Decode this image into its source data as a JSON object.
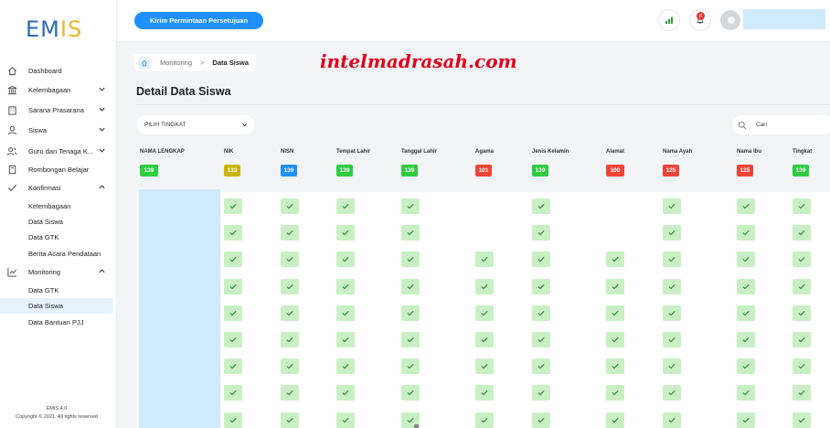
{
  "app": {
    "logo_main": "EM",
    "logo_accent": "IS"
  },
  "sidebar": {
    "items": [
      {
        "label": "Dashboard",
        "icon": "home-icon",
        "chevron": ""
      },
      {
        "label": "Kelembagaan",
        "icon": "institution-icon",
        "chevron": "down"
      },
      {
        "label": "Sarana Prasarana",
        "icon": "building-icon",
        "chevron": "down"
      },
      {
        "label": "Siswa",
        "icon": "user-icon",
        "chevron": "down"
      },
      {
        "label": "Guru dan Tenaga K...",
        "icon": "users-icon",
        "chevron": "down"
      },
      {
        "label": "Rombongan Belajar",
        "icon": "book-icon",
        "chevron": ""
      },
      {
        "label": "Konfirmasi",
        "icon": "check-icon",
        "chevron": "up"
      }
    ],
    "konfirmasi_sub": [
      "Kelembagaan",
      "Data Siswa",
      "Data GTK",
      "Berita Acara Pendataan"
    ],
    "monitoring": {
      "label": "Monitoring",
      "icon": "chart-line-icon",
      "chevron": "up"
    },
    "monitoring_sub": [
      "Data GTK",
      "Data Siswa",
      "Data Bantuan PJJ"
    ],
    "active_sub": "Data Siswa",
    "footer_version": "EMIS 4.0",
    "footer_copyright": "Copyright © 2021. All rights reserved"
  },
  "topbar": {
    "request_button": "Kirim Permintaan Persetujuan",
    "notification_count": "8",
    "icons": [
      "signal-bars-icon",
      "bell-icon",
      "avatar-icon"
    ]
  },
  "breadcrumb": {
    "parent": "Monitoring",
    "separator": ">",
    "current": "Data Siswa"
  },
  "watermark": "intelmadrasah.com",
  "page_title": "Detail Data Siswa",
  "filter": {
    "select_value": "PILIH TINGKAT",
    "search_placeholder": "Cari"
  },
  "colors": {
    "green": "#2ecc40",
    "yellow": "#c8b400",
    "blue": "#1e90ff",
    "red": "#f0443a",
    "check_bg": "#c9f0c4",
    "accent": "#1e90ff"
  },
  "table": {
    "columns": [
      {
        "label": "NAMA LENGKAP",
        "count": "139",
        "color": "green"
      },
      {
        "label": "NIK",
        "count": "133",
        "color": "yellow"
      },
      {
        "label": "NISN",
        "count": "139",
        "color": "blue"
      },
      {
        "label": "Tempat Lahir",
        "count": "139",
        "color": "green"
      },
      {
        "label": "Tanggal Lahir",
        "count": "139",
        "color": "green"
      },
      {
        "label": "Agama",
        "count": "101",
        "color": "red"
      },
      {
        "label": "Jenis Kelamin",
        "count": "139",
        "color": "green"
      },
      {
        "label": "Alamat",
        "count": "100",
        "color": "red"
      },
      {
        "label": "Nama Ayah",
        "count": "125",
        "color": "red"
      },
      {
        "label": "Nama Ibu",
        "count": "125",
        "color": "red"
      },
      {
        "label": "Tingkat",
        "count": "139",
        "color": "green"
      }
    ],
    "rows": [
      [
        true,
        true,
        true,
        true,
        false,
        true,
        false,
        true,
        true,
        true
      ],
      [
        true,
        true,
        true,
        true,
        false,
        true,
        false,
        true,
        true,
        true
      ],
      [
        true,
        true,
        true,
        true,
        true,
        true,
        true,
        true,
        true,
        true
      ],
      [
        true,
        true,
        true,
        true,
        true,
        true,
        true,
        true,
        true,
        true
      ],
      [
        true,
        true,
        true,
        true,
        true,
        true,
        true,
        true,
        true,
        true
      ],
      [
        true,
        true,
        true,
        true,
        true,
        true,
        true,
        true,
        true,
        true
      ],
      [
        true,
        true,
        true,
        true,
        true,
        true,
        true,
        true,
        true,
        true
      ],
      [
        true,
        true,
        true,
        true,
        true,
        true,
        true,
        true,
        true,
        true
      ],
      [
        true,
        true,
        true,
        true,
        true,
        true,
        true,
        true,
        true,
        true
      ]
    ]
  }
}
